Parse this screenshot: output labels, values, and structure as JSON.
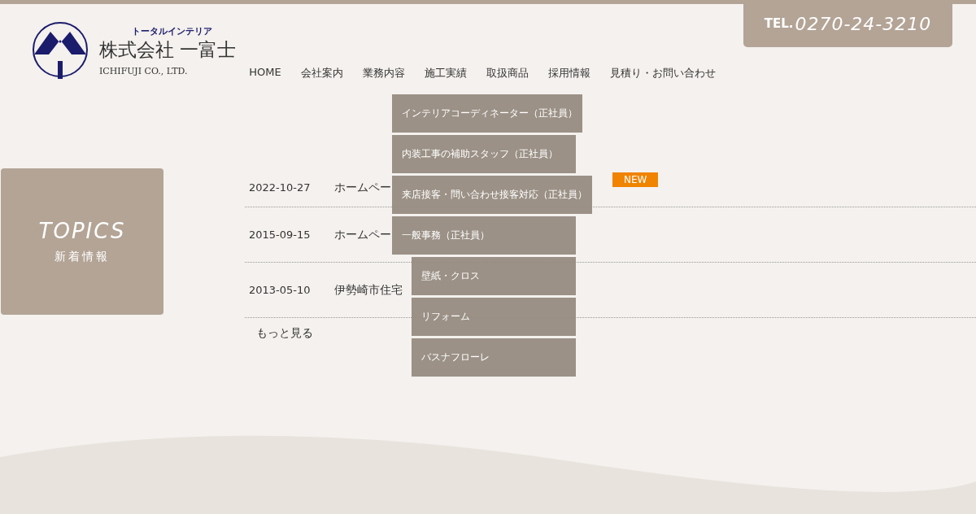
{
  "logo": {
    "tagline": "トータルインテリア",
    "name": "株式会社 一富士",
    "english": "ICHIFUJI CO., LTD."
  },
  "tel": {
    "prefix": "TEL.",
    "number": "0270-24-3210"
  },
  "nav": [
    "HOME",
    "会社案内",
    "業務内容",
    "施工実績",
    "取扱商品",
    "採用情報",
    "見積り・お問い合わせ"
  ],
  "recruit_menu": [
    "インテリアコーディネーター（正社員）",
    "内装工事の補助スタッフ（正社員）",
    "来店接客・問い合わせ接客対応（正社員）",
    "一般事務（正社員）"
  ],
  "products_menu": [
    "壁紙・クロス",
    "リフォーム",
    "バスナフローレ"
  ],
  "topics": {
    "title": "TOPICS",
    "subtitle": "新着情報"
  },
  "news": [
    {
      "date": "2022-10-27",
      "title": "ホームペー",
      "new": true,
      "badge": "NEW"
    },
    {
      "date": "2015-09-15",
      "title": "ホームペー",
      "new": false
    },
    {
      "date": "2013-05-10",
      "title": "伊勢崎市住宅",
      "new": false
    }
  ],
  "more": "もっと見る"
}
